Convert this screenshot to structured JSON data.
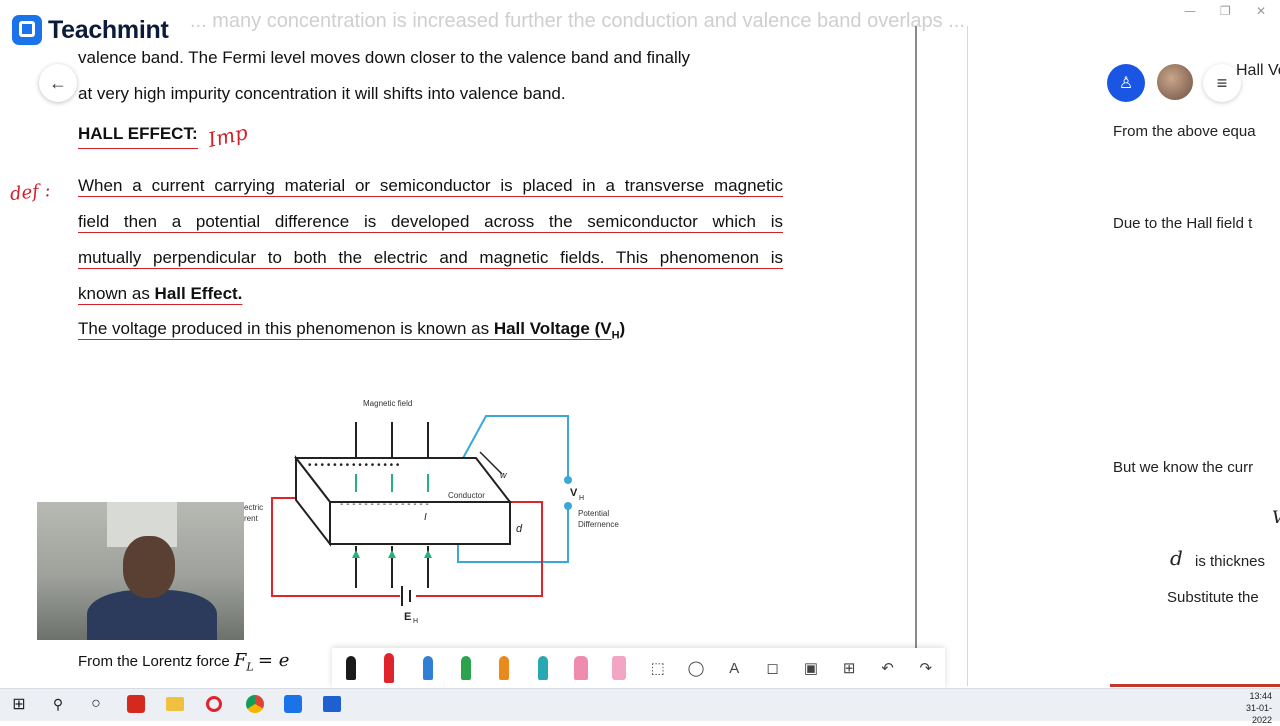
{
  "app": {
    "brand": "Teachmint",
    "window_controls": [
      "—",
      "❐",
      "✕"
    ]
  },
  "document": {
    "top_ghost_text": "... many concentration is increased further the conduction and valence band overlaps ...",
    "para1": [
      "valence band. The Fermi level moves down closer to the valence band and finally",
      "at very high impurity concentration it will shifts into valence band."
    ],
    "heading": "HALL EFFECT:",
    "annotation_imp": "Imp",
    "annotation_def": "def :",
    "def_lines": [
      "When a current carrying material or semiconductor is placed in a transverse magnetic",
      "field then a potential difference is developed across the semiconductor which is",
      "mutually perpendicular to both the electric and magnetic fields. This phenomenon is"
    ],
    "def_last_prefix": "known as ",
    "def_last_bold": "Hall Effect.",
    "voltage_prefix": "The voltage produced in this phenomenon is known as ",
    "voltage_bold": "Hall Voltage (V",
    "voltage_sub": "H",
    "voltage_suffix": ")",
    "diagram": {
      "magnetic_field": "Magnetic field",
      "conductor": "Conductor",
      "w": "w",
      "d": "d",
      "i": "I",
      "vh": "V",
      "vh_sub": "H",
      "potential": "Potential",
      "difference": "Differnence",
      "electric": "ectric",
      "current": "rent",
      "eh": "E",
      "eh_sub": "H"
    },
    "lorentz_text": "From the Lorentz force",
    "lorentz_formula": "F",
    "lorentz_sub": "L",
    "lorentz_rhs": "= e"
  },
  "right_page": {
    "title_partial": "Hall Ve",
    "line1": "From the above equa",
    "line2": "Due to the Hall field t",
    "line3": "But we know the curr",
    "line4_v": "V",
    "line5_d": "d",
    "line5_text": "is thicknes",
    "line6": "Substitute the"
  },
  "nav": {
    "back": "←",
    "user": "♙",
    "menu": "≡"
  },
  "toolbar": {
    "tools": [
      {
        "name": "pen-black",
        "color": "#1a1a1a"
      },
      {
        "name": "pen-red",
        "color": "#e0242e"
      },
      {
        "name": "pen-blue",
        "color": "#2f7fd6"
      },
      {
        "name": "pen-green",
        "color": "#2aa34a"
      },
      {
        "name": "pen-orange",
        "color": "#e98a1c"
      },
      {
        "name": "pen-teal",
        "color": "#27a8b2"
      },
      {
        "name": "highlighter-pink",
        "color": "#f08bb0"
      },
      {
        "name": "eraser",
        "color": "#f2a6c4"
      }
    ],
    "icons": [
      "⬚",
      "◯",
      "A",
      "◻",
      "▣",
      "⊞",
      "↶",
      "↷"
    ]
  },
  "taskbar": {
    "start": "⊞",
    "search": "⚲",
    "cortana": "○",
    "clock_time": "13:44",
    "clock_date": "31-01-2022"
  }
}
